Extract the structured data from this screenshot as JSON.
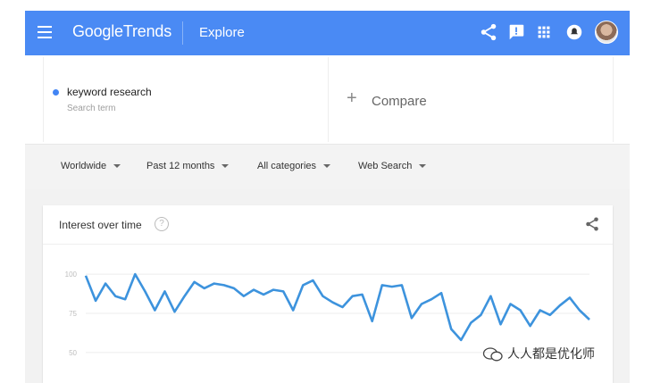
{
  "header": {
    "brand_google": "Google",
    "brand_trends": "Trends",
    "section": "Explore",
    "color": "#4a8af4"
  },
  "term": {
    "label": "keyword research",
    "sub": "Search term",
    "color": "#4285f4"
  },
  "compare": {
    "label": "Compare",
    "icon": "plus-icon"
  },
  "filters": [
    {
      "label": "Worldwide"
    },
    {
      "label": "Past 12 months"
    },
    {
      "label": "All categories"
    },
    {
      "label": "Web Search"
    }
  ],
  "card": {
    "title": "Interest over time",
    "help": "?"
  },
  "chart_data": {
    "type": "line",
    "color": "#3d93dd",
    "ylim": [
      38,
      112
    ],
    "yticks": [
      {
        "value": 100,
        "label": "100"
      },
      {
        "value": 75,
        "label": "75"
      },
      {
        "value": 50,
        "label": "50"
      }
    ],
    "series": [
      {
        "values": [
          99,
          83,
          94,
          86,
          84,
          100,
          89,
          77,
          89,
          76,
          86,
          95,
          91,
          94,
          93,
          91,
          86,
          90,
          87,
          90,
          89,
          77,
          93,
          96,
          86,
          82,
          79,
          86,
          87,
          70,
          93,
          92,
          93,
          72,
          81,
          84,
          88,
          65,
          58,
          69,
          74,
          86,
          68,
          81,
          77,
          67,
          77,
          74,
          80,
          85,
          77,
          71
        ]
      }
    ]
  },
  "watermark": "人人都是优化师"
}
